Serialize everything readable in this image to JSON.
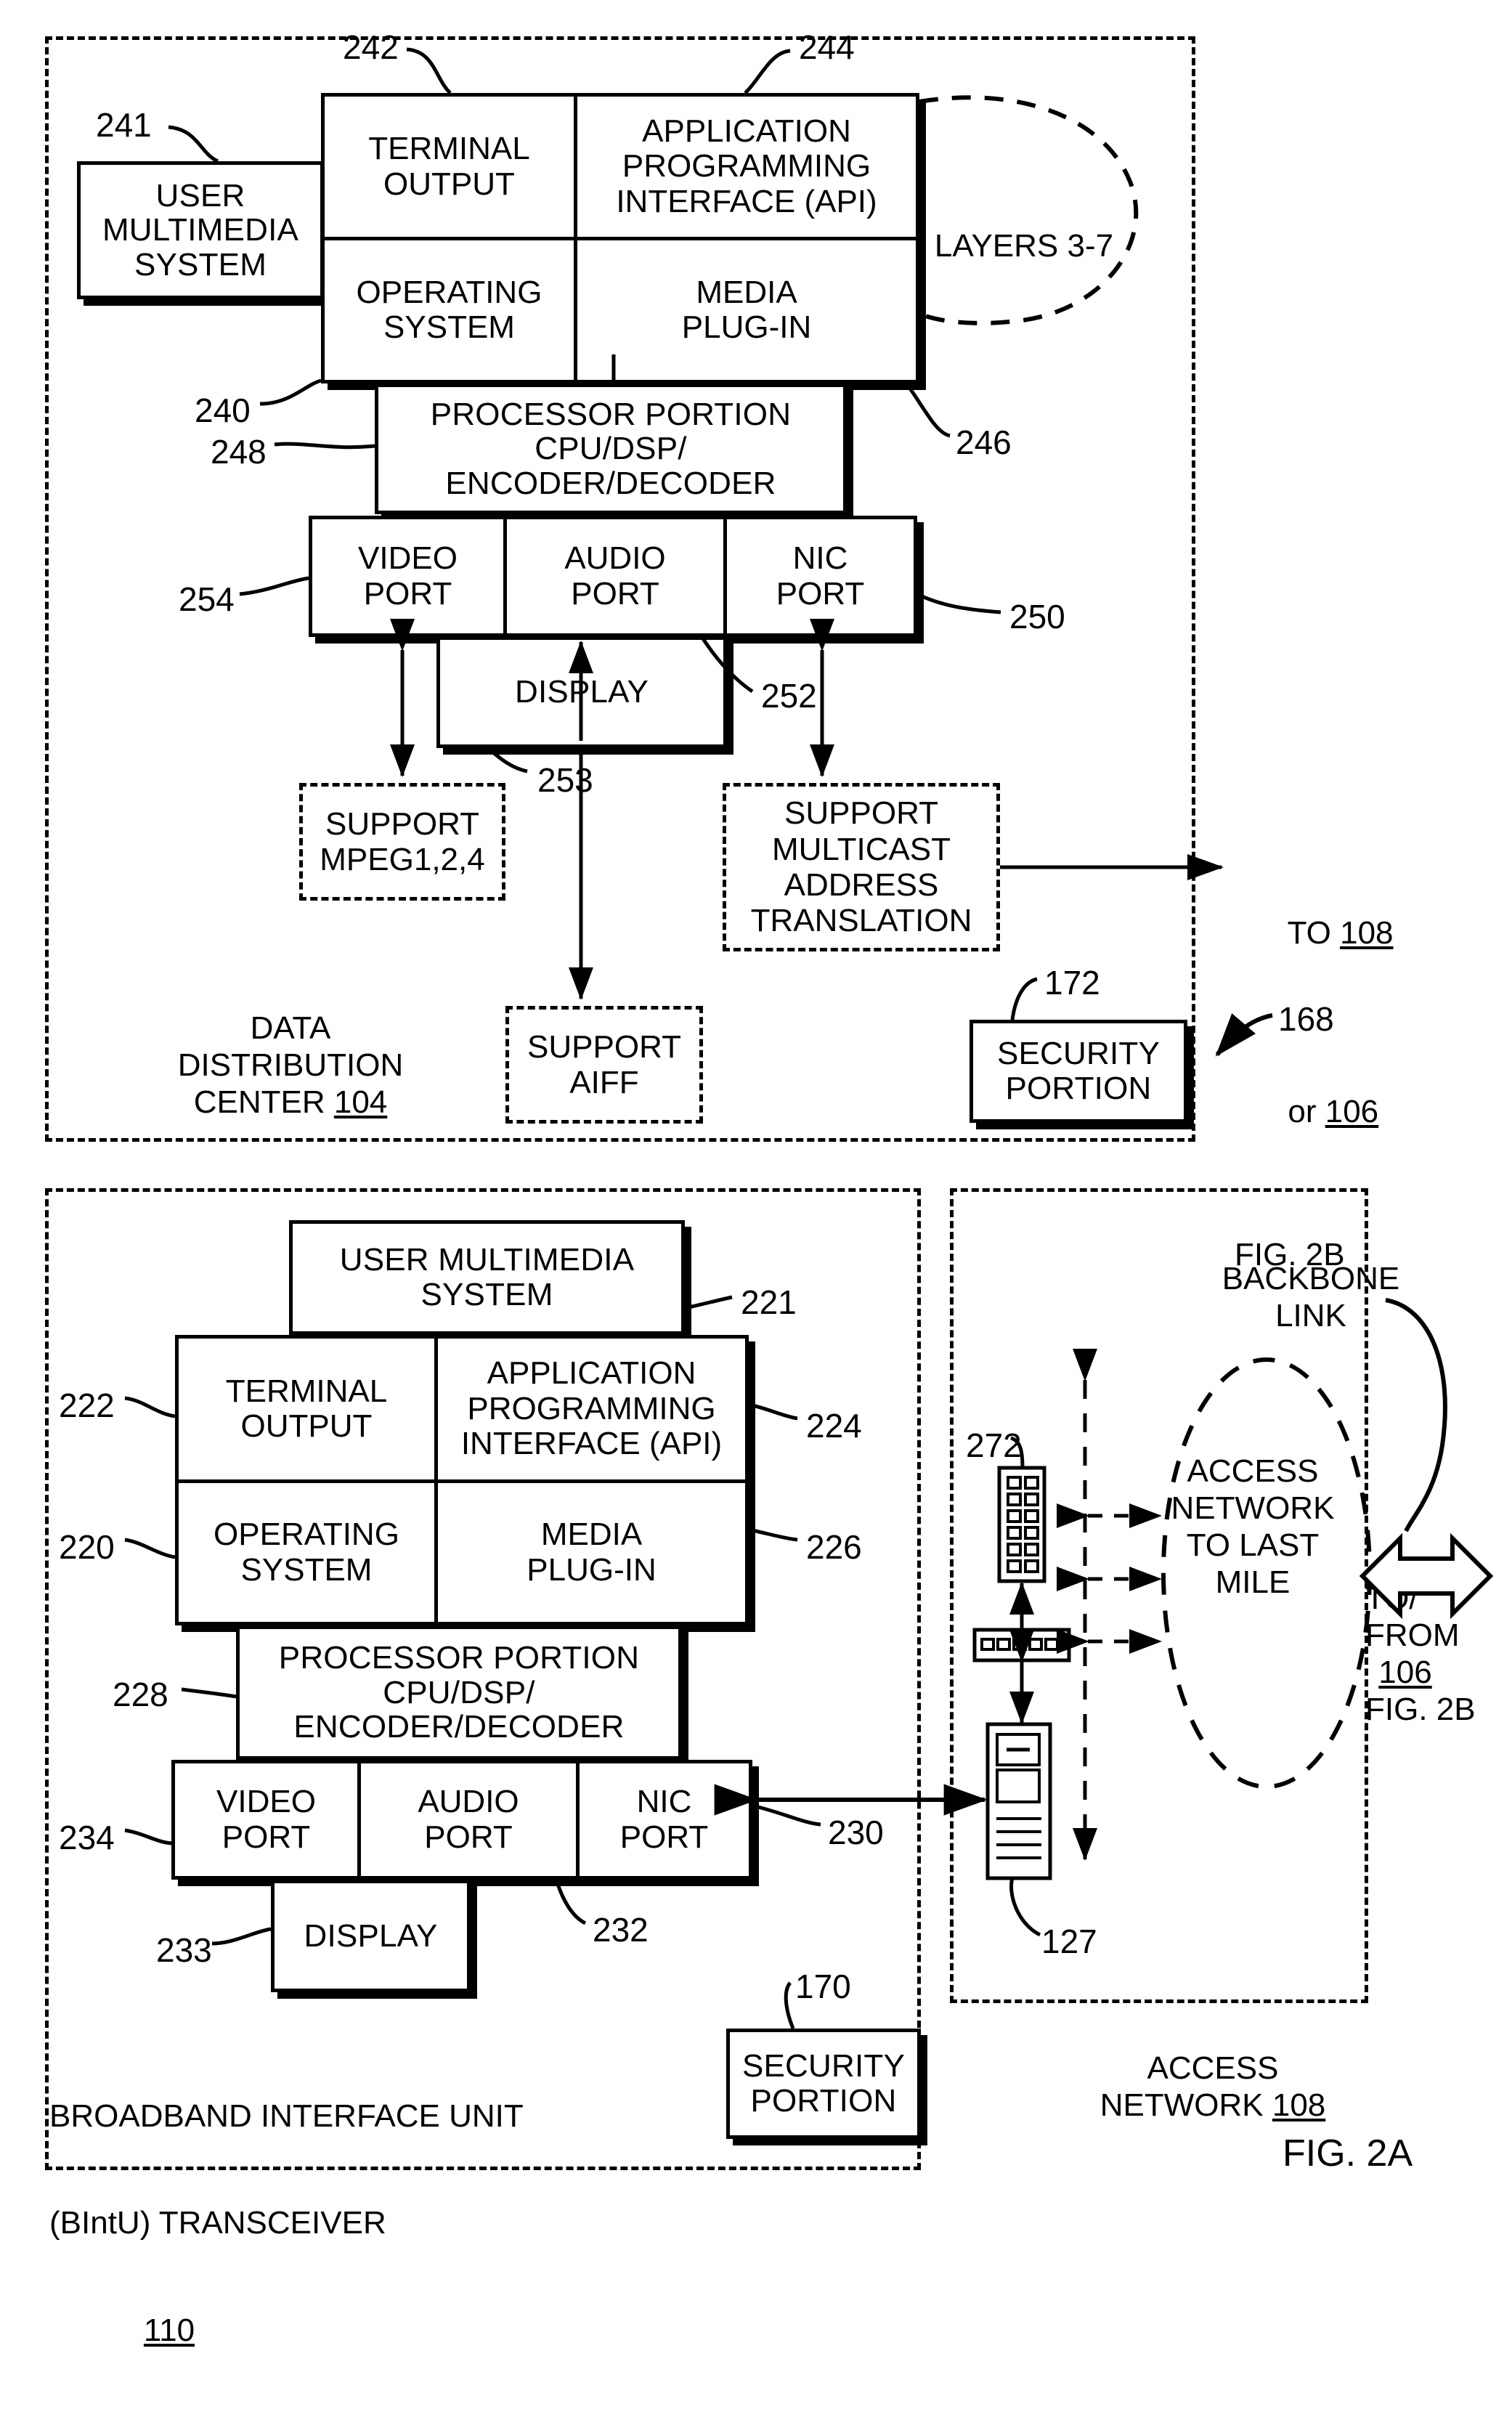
{
  "figure": {
    "label": "FIG. 2A"
  },
  "top_panel": {
    "container_label_lines": [
      "DATA",
      "DISTRIBUTION",
      "CENTER "
    ],
    "container_ref": "104",
    "ref_168": "168",
    "blocks": {
      "user_multimedia_system": {
        "label": "USER\nMULTIMEDIA\nSYSTEM",
        "ref": "241"
      },
      "terminal_output": {
        "label": "TERMINAL\nOUTPUT",
        "ref": "242"
      },
      "api": {
        "label": "APPLICATION\nPROGRAMMING\nINTERFACE (API)",
        "ref": "244"
      },
      "operating_system": {
        "label": "OPERATING\nSYSTEM",
        "ref": "240"
      },
      "media_plugin": {
        "label": "MEDIA\nPLUG-IN",
        "ref": "246"
      },
      "processor_portion": {
        "label": "PROCESSOR PORTION\nCPU/DSP/\nENCODER/DECODER",
        "ref": "248"
      },
      "video_port": {
        "label": "VIDEO\nPORT",
        "ref": "254"
      },
      "audio_port": {
        "label": "AUDIO\nPORT",
        "ref": "252"
      },
      "nic_port": {
        "label": "NIC\nPORT",
        "ref": "250"
      },
      "display": {
        "label": "DISPLAY",
        "ref": "253"
      },
      "security_portion": {
        "label": "SECURITY\nPORTION",
        "ref": "172"
      }
    },
    "layers_label": "LAYERS 3-7",
    "dashed_blocks": {
      "support_mpeg": "SUPPORT\nMPEG1,2,4",
      "support_multicast": "SUPPORT\nMULTICAST\nADDRESS\nTRANSLATION",
      "support_aiff": "SUPPORT\nAIFF"
    },
    "exit_note": {
      "line1_prefix": "TO ",
      "line1_ref": "108",
      "line2_prefix": "or ",
      "line2_ref": "106",
      "line3": "FIG. 2B"
    }
  },
  "bottom_panel": {
    "container_label_lines": [
      "BROADBAND INTERFACE UNIT",
      "(BIntU) TRANSCEIVER"
    ],
    "container_ref": "110",
    "blocks": {
      "user_multimedia_system": {
        "label": "USER MULTIMEDIA\nSYSTEM",
        "ref": "221"
      },
      "terminal_output": {
        "label": "TERMINAL\nOUTPUT",
        "ref": "222"
      },
      "api": {
        "label": "APPLICATION\nPROGRAMMING\nINTERFACE (API)",
        "ref": "224"
      },
      "operating_system": {
        "label": "OPERATING\nSYSTEM",
        "ref": "220"
      },
      "media_plugin": {
        "label": "MEDIA\nPLUG-IN",
        "ref": "226"
      },
      "processor_portion": {
        "label": "PROCESSOR PORTION\nCPU/DSP/\nENCODER/DECODER",
        "ref": "228"
      },
      "video_port": {
        "label": "VIDEO\nPORT",
        "ref": "234"
      },
      "audio_port": {
        "label": "AUDIO\nPORT",
        "ref": "232"
      },
      "nic_port": {
        "label": "NIC\nPORT",
        "ref": "230"
      },
      "display": {
        "label": "DISPLAY",
        "ref": "233"
      },
      "security_portion": {
        "label": "SECURITY\nPORTION",
        "ref": "170"
      }
    }
  },
  "access_network_panel": {
    "title_prefix": "ACCESS",
    "title_line2_prefix": "NETWORK ",
    "title_ref": "108",
    "cloud_label": "ACCESS\nNETWORK\nTO LAST\nMILE",
    "backbone_label": "BACKBONE\nLINK",
    "equipment_ref_top": "272",
    "equipment_ref_bottom": "127",
    "exit_note": {
      "line1": "TO/",
      "line2": "FROM",
      "line3_ref": "106",
      "line4": "FIG. 2B"
    }
  }
}
